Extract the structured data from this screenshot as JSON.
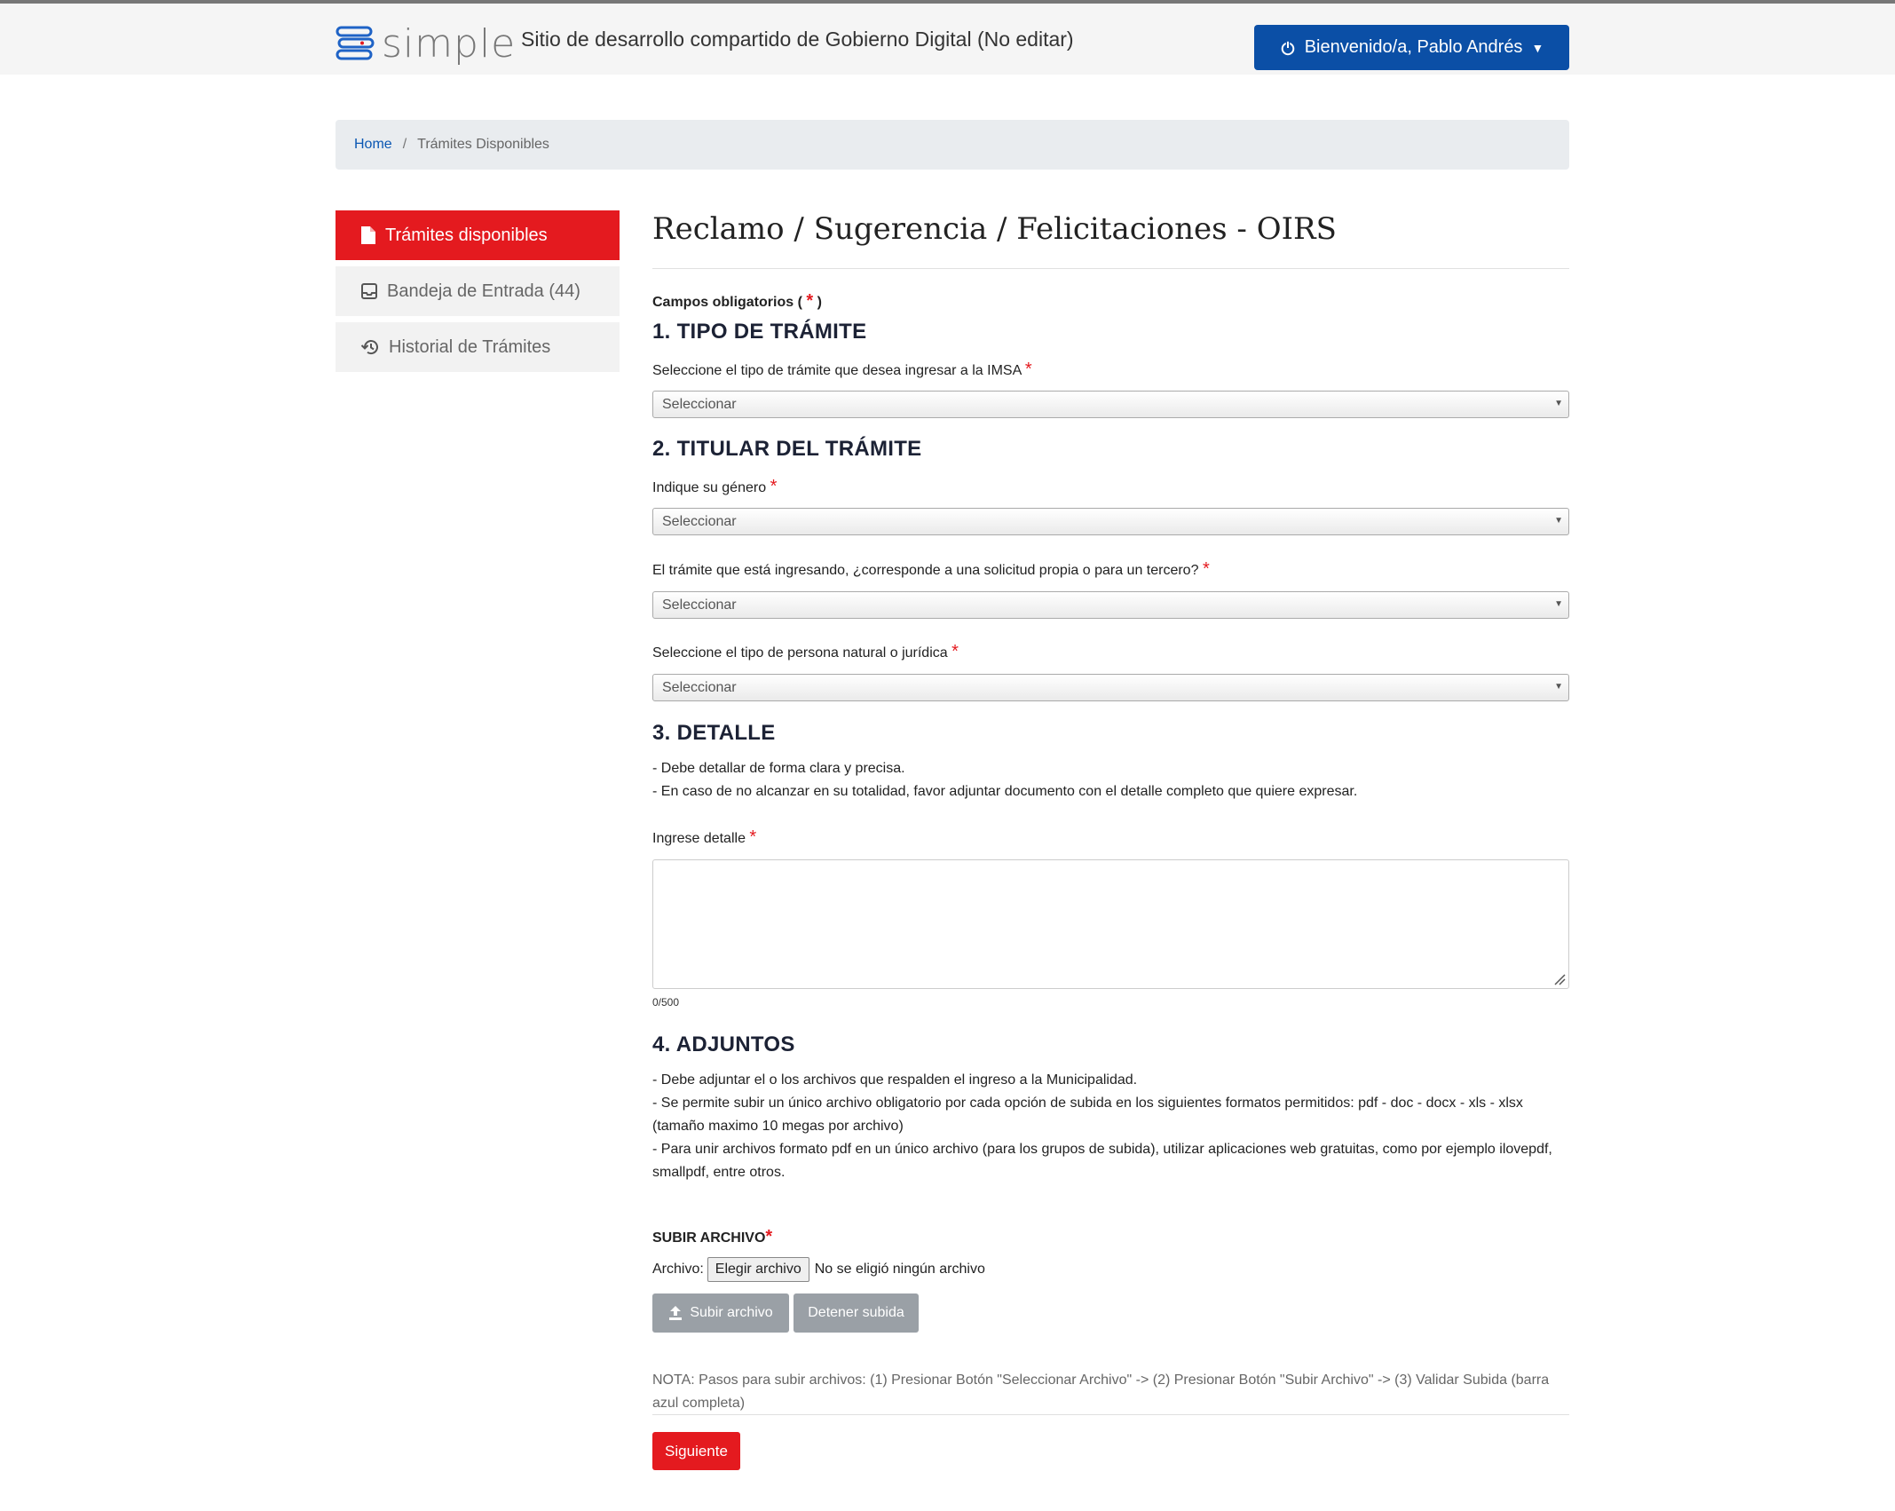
{
  "header": {
    "logo_text": "simple",
    "site_title": "Sitio de desarrollo compartido de Gobierno Digital (No editar)",
    "user_label": "Bienvenido/a, Pablo Andrés"
  },
  "breadcrumb": {
    "home": "Home",
    "separator": "/",
    "current": "Trámites Disponibles"
  },
  "sidebar": {
    "items": [
      {
        "label": "Trámites disponibles",
        "icon": "document-icon",
        "active": true
      },
      {
        "label": "Bandeja de Entrada (44)",
        "icon": "inbox-icon",
        "active": false
      },
      {
        "label": "Historial de Trámites",
        "icon": "history-icon",
        "active": false
      }
    ]
  },
  "form": {
    "title": "Reclamo / Sugerencia / Felicitaciones - OIRS",
    "required_note_prefix": "Campos obligatorios (",
    "required_star": "*",
    "required_note_suffix": ")",
    "sections": {
      "s1": "1. TIPO DE TRÁMITE",
      "s2": "2. TITULAR DEL TRÁMITE",
      "s3": "3. DETALLE",
      "s4": "4. ADJUNTOS"
    },
    "fields": {
      "tipo_tramite_label": "Seleccione el tipo de trámite que desea ingresar a la IMSA",
      "genero_label": "Indique su género",
      "solicitud_label": "El trámite que está ingresando, ¿corresponde a una solicitud propia o para un tercero?",
      "persona_label": "Seleccione el tipo de persona natural o jurídica",
      "select_placeholder": "Seleccionar",
      "detalle_label": "Ingrese detalle",
      "counter": "0/500"
    },
    "detalle_desc": [
      "- Debe detallar de forma clara y precisa.",
      "- En caso de no alcanzar en su totalidad, favor adjuntar documento con el detalle completo que quiere expresar."
    ],
    "adjuntos_desc": [
      "- Debe adjuntar el o los archivos que respalden el ingreso a la Municipalidad.",
      "- Se permite subir un único archivo obligatorio por cada opción de subida en los siguientes formatos permitidos: pdf - doc - docx - xls - xlsx (tamaño maximo 10 megas por archivo)",
      "- Para unir archivos formato pdf en un único archivo (para los grupos de subida), utilizar aplicaciones web gratuitas, como por ejemplo ilovepdf, smallpdf, entre otros."
    ],
    "upload": {
      "label": "SUBIR ARCHIVO",
      "file_label": "Archivo:",
      "choose_button": "Elegir archivo",
      "no_file": "No se eligió ningún archivo",
      "upload_button": "Subir archivo",
      "stop_button": "Detener subida",
      "note": "NOTA: Pasos para subir archivos: (1) Presionar Botón \"Seleccionar Archivo\" -> (2) Presionar Botón \"Subir Archivo\" -> (3) Validar Subida (barra azul completa)"
    },
    "next_button": "Siguiente"
  },
  "colors": {
    "accent_red": "#e41a1f",
    "primary_blue": "#0b4fa6"
  }
}
